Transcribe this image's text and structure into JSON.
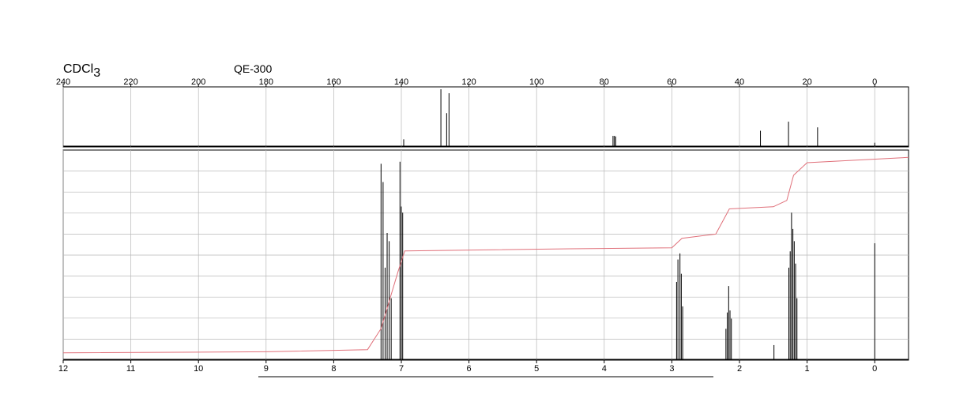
{
  "header": {
    "solvent": "CDCl",
    "solvent_subscript": "3",
    "instrument": "QE-300"
  },
  "colors": {
    "frame": "#000000",
    "grid": "#b8b8b8",
    "trace": "#000000",
    "integral": "#e0707a"
  },
  "chart_data": [
    {
      "type": "line",
      "name": "13C",
      "title": "",
      "xlabel": "",
      "ylabel": "",
      "xlim": [
        240,
        -10
      ],
      "x_reversed": true,
      "ticks": [
        "240",
        "220",
        "200",
        "180",
        "160",
        "140",
        "120",
        "100",
        "80",
        "60",
        "40",
        "20",
        "0"
      ],
      "tick_values": [
        240,
        220,
        200,
        180,
        160,
        140,
        120,
        100,
        80,
        60,
        40,
        20,
        0
      ],
      "grid": true,
      "peaks": [
        {
          "x": 139.3,
          "h": 0.12
        },
        {
          "x": 128.3,
          "h": 1.0
        },
        {
          "x": 126.6,
          "h": 0.58
        },
        {
          "x": 125.9,
          "h": 0.93
        },
        {
          "x": 77.4,
          "h": 0.18
        },
        {
          "x": 77.0,
          "h": 0.18
        },
        {
          "x": 76.6,
          "h": 0.17
        },
        {
          "x": 33.8,
          "h": 0.27
        },
        {
          "x": 25.5,
          "h": 0.43
        },
        {
          "x": 16.9,
          "h": 0.33
        },
        {
          "x": 0.0,
          "h": 0.06
        }
      ]
    },
    {
      "type": "line",
      "name": "1H",
      "title": "",
      "xlabel": "",
      "ylabel": "",
      "xlim": [
        12,
        -0.5
      ],
      "x_reversed": true,
      "ticks": [
        "12",
        "11",
        "10",
        "9",
        "8",
        "7",
        "6",
        "5",
        "4",
        "3",
        "2",
        "1",
        "0"
      ],
      "tick_values": [
        12,
        11,
        10,
        9,
        8,
        7,
        6,
        5,
        4,
        3,
        2,
        1,
        0
      ],
      "grid": true,
      "peaks": [
        {
          "x": 7.3,
          "h": 0.96
        },
        {
          "x": 7.27,
          "h": 0.87
        },
        {
          "x": 7.24,
          "h": 0.45
        },
        {
          "x": 7.21,
          "h": 0.62
        },
        {
          "x": 7.18,
          "h": 0.58
        },
        {
          "x": 7.15,
          "h": 0.3
        },
        {
          "x": 7.02,
          "h": 0.97
        },
        {
          "x": 7.0,
          "h": 0.75
        },
        {
          "x": 6.98,
          "h": 0.72
        },
        {
          "x": 2.93,
          "h": 0.38
        },
        {
          "x": 2.91,
          "h": 0.49
        },
        {
          "x": 2.88,
          "h": 0.52
        },
        {
          "x": 2.86,
          "h": 0.42
        },
        {
          "x": 2.84,
          "h": 0.26
        },
        {
          "x": 2.2,
          "h": 0.15
        },
        {
          "x": 2.18,
          "h": 0.23
        },
        {
          "x": 2.16,
          "h": 0.36
        },
        {
          "x": 2.14,
          "h": 0.24
        },
        {
          "x": 2.12,
          "h": 0.2
        },
        {
          "x": 1.49,
          "h": 0.07
        },
        {
          "x": 1.27,
          "h": 0.45
        },
        {
          "x": 1.25,
          "h": 0.53
        },
        {
          "x": 1.23,
          "h": 0.72
        },
        {
          "x": 1.21,
          "h": 0.64
        },
        {
          "x": 1.19,
          "h": 0.58
        },
        {
          "x": 1.17,
          "h": 0.47
        },
        {
          "x": 1.15,
          "h": 0.3
        },
        {
          "x": 0.0,
          "h": 0.57
        }
      ],
      "integral": [
        [
          12,
          0.035
        ],
        [
          9,
          0.04
        ],
        [
          7.5,
          0.05
        ],
        [
          7.3,
          0.15
        ],
        [
          7.05,
          0.42
        ],
        [
          6.95,
          0.52
        ],
        [
          4.5,
          0.53
        ],
        [
          3.0,
          0.535
        ],
        [
          2.85,
          0.58
        ],
        [
          2.35,
          0.6
        ],
        [
          2.15,
          0.72
        ],
        [
          1.5,
          0.73
        ],
        [
          1.3,
          0.76
        ],
        [
          1.2,
          0.88
        ],
        [
          1.0,
          0.94
        ],
        [
          -0.5,
          0.965
        ]
      ]
    }
  ]
}
